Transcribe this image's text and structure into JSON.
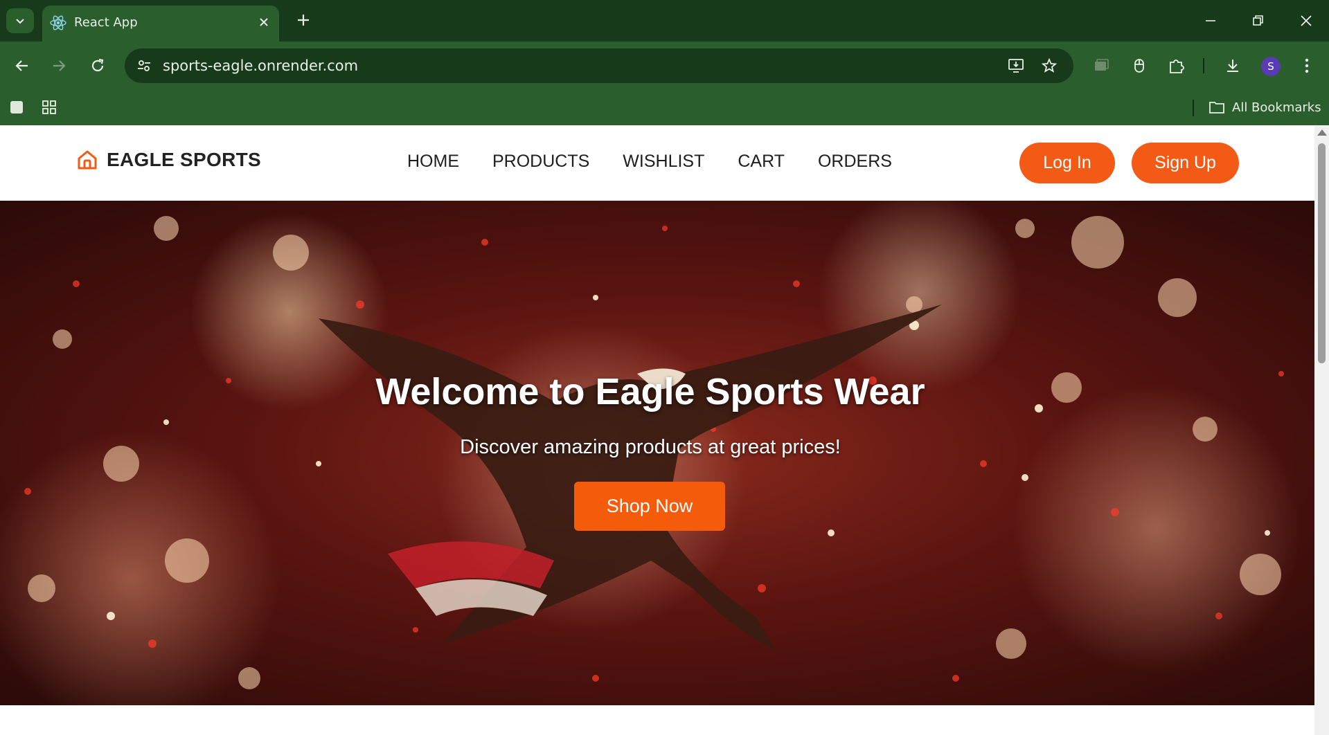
{
  "browser": {
    "tab_title": "React App",
    "url": "sports-eagle.onrender.com",
    "profile_initial": "S",
    "bookmarks_label": "All Bookmarks",
    "accent_color": "#2a5e2c"
  },
  "site": {
    "brand": "EAGLE SPORTS",
    "nav": [
      {
        "label": "HOME"
      },
      {
        "label": "PRODUCTS"
      },
      {
        "label": "WISHLIST"
      },
      {
        "label": "CART"
      },
      {
        "label": "ORDERS"
      }
    ],
    "login_label": "Log In",
    "signup_label": "Sign Up",
    "accent_color": "#f35a15"
  },
  "hero": {
    "title": "Welcome to Eagle Sports Wear",
    "subtitle": "Discover amazing products at great prices!",
    "cta_label": "Shop Now"
  }
}
